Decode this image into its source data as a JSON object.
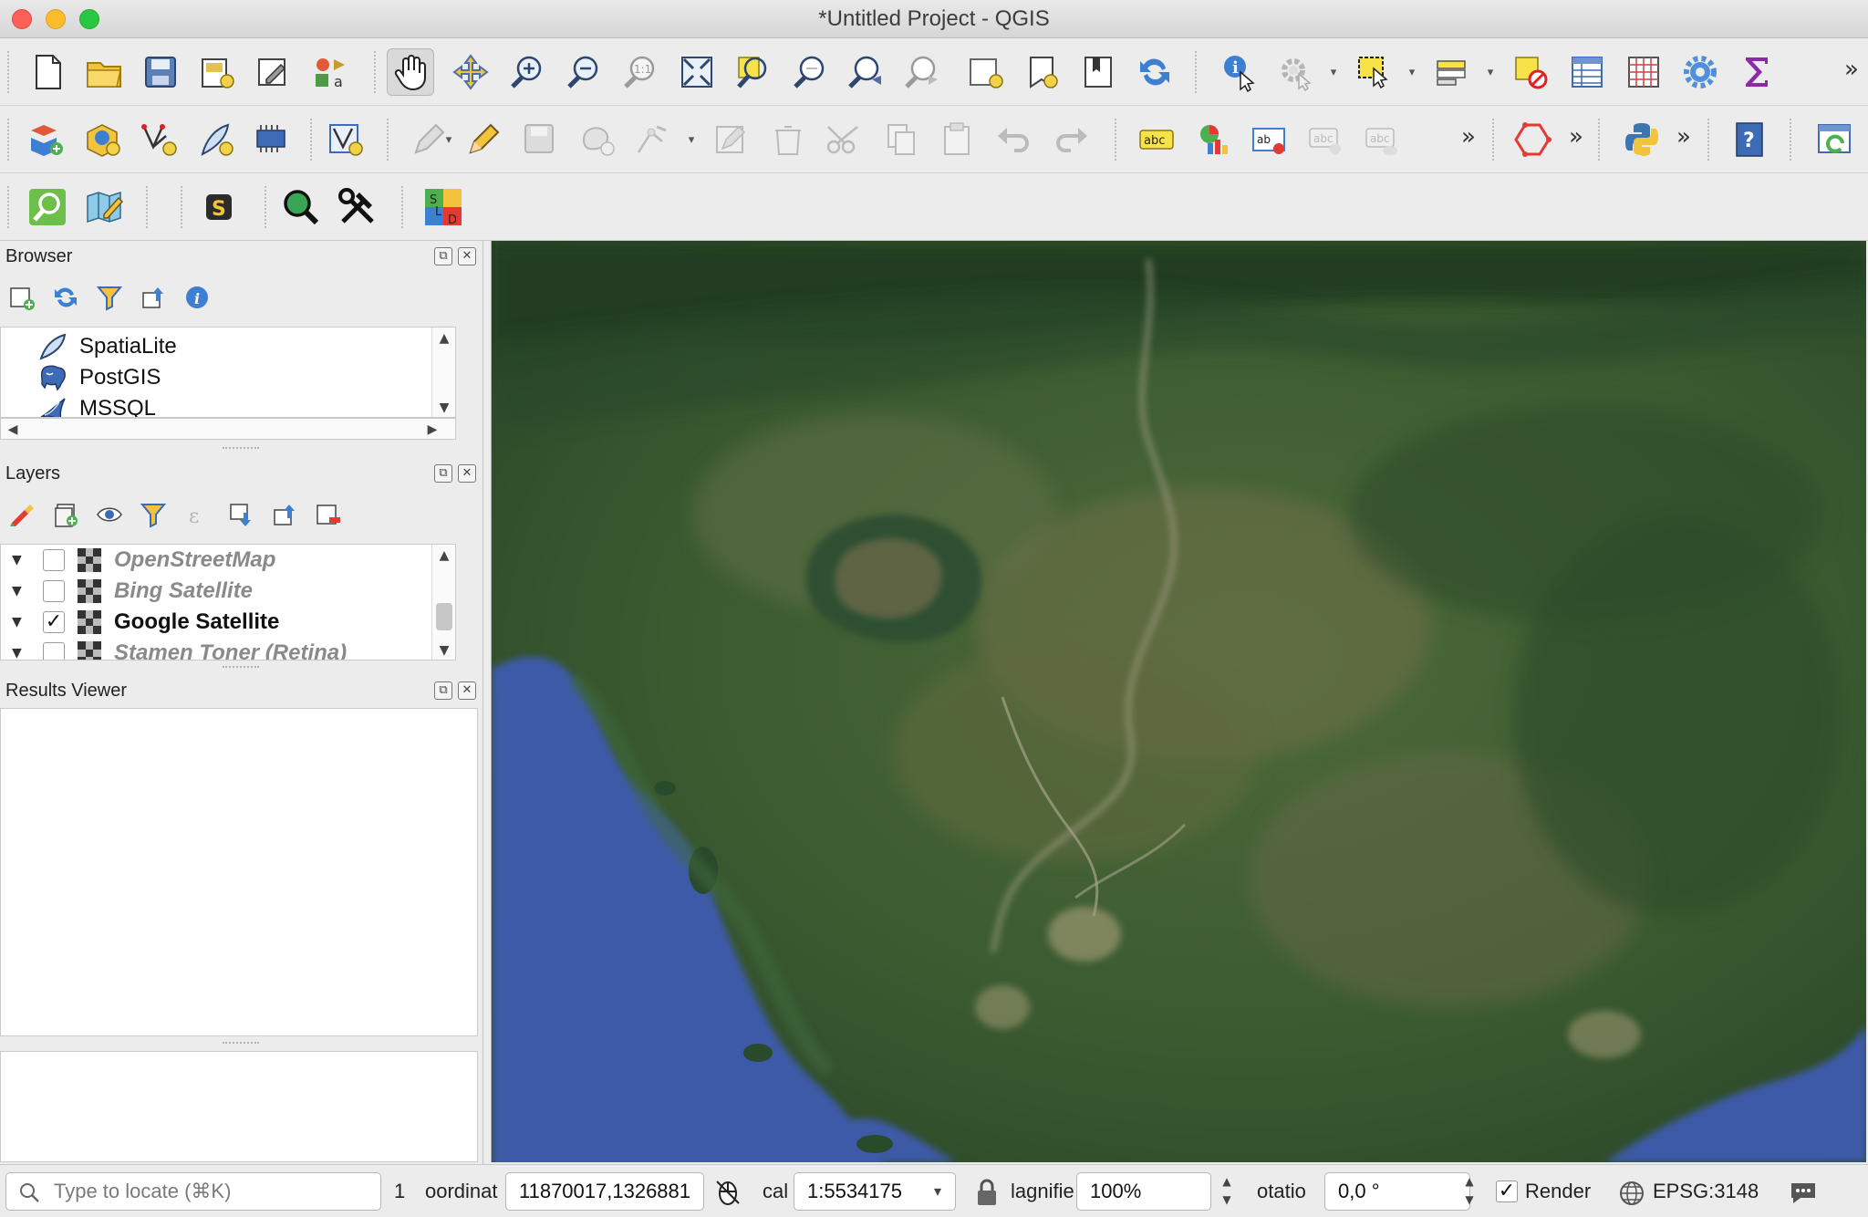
{
  "window": {
    "title": "*Untitled Project - QGIS"
  },
  "toolbar": {
    "overflow_label": "»",
    "dropdown_arrow": "▾"
  },
  "browser": {
    "title": "Browser",
    "items": [
      {
        "label": "SpatiaLite",
        "icon": "spatialite-feather-icon"
      },
      {
        "label": "PostGIS",
        "icon": "postgis-elephant-icon"
      },
      {
        "label": "MSSQL",
        "icon": "mssql-icon"
      }
    ]
  },
  "layers": {
    "title": "Layers",
    "items": [
      {
        "label": "OpenStreetMap",
        "checked": false,
        "icon": "raster-tile-icon"
      },
      {
        "label": "Bing Satellite",
        "checked": false,
        "icon": "raster-tile-icon"
      },
      {
        "label": "Google Satellite",
        "checked": true,
        "icon": "raster-tile-icon"
      },
      {
        "label": "Stamen Toner (Retina)",
        "checked": false,
        "icon": "raster-tile-icon"
      }
    ]
  },
  "results": {
    "title": "Results Viewer"
  },
  "panel_buttons": {
    "float": "⧉",
    "close": "✕"
  },
  "status": {
    "locator_placeholder": "Type to locate (⌘K)",
    "msg_count": "1",
    "coordinate_label": "oordinat",
    "coordinate_value": "11870017,1326881",
    "scale_label": "cal",
    "scale_value": "1:5534175",
    "magnifier_label": "lagnifie",
    "magnifier_value": "100%",
    "rotation_label": "otatio",
    "rotation_value": "0,0 °",
    "render_label": "Render",
    "render_checked": "✓",
    "crs": "EPSG:3148"
  },
  "colors": {
    "sea": "#3e5aa8",
    "land_dark": "#2f4a2c",
    "land_mid": "#4a6136",
    "land_light": "#7a7a56",
    "river": "#a7a38a"
  }
}
